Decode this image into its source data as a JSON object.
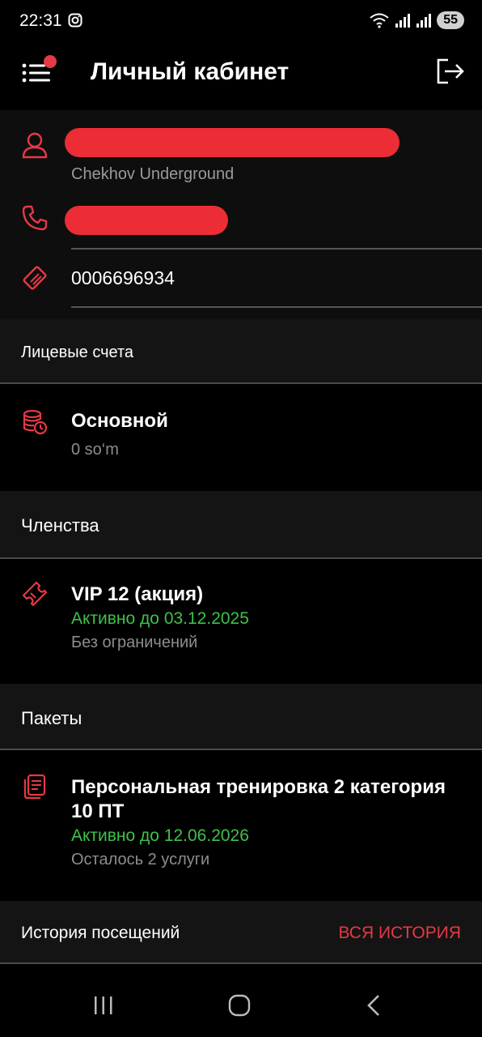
{
  "status": {
    "time": "22:31",
    "battery": "55"
  },
  "header": {
    "title": "Личный кабинет"
  },
  "profile": {
    "club": "Chekhov Underground",
    "card_number": "0006696934"
  },
  "accounts": {
    "title": "Лицевые счета",
    "items": [
      {
        "name": "Основной",
        "balance": "0 so‘m"
      }
    ]
  },
  "memberships": {
    "title": "Членства",
    "items": [
      {
        "name": "VIP 12 (акция)",
        "status": "Активно до 03.12.2025",
        "note": "Без ограничений"
      }
    ]
  },
  "packages": {
    "title": "Пакеты",
    "items": [
      {
        "name_line1": "Персональная тренировка 2 категория",
        "name_line2": "10 ПТ",
        "status": "Активно до 12.06.2026",
        "note": "Осталось 2 услуги"
      }
    ]
  },
  "history": {
    "title": "История посещений",
    "link": "ВСЯ ИСТОРИЯ"
  },
  "colors": {
    "accent": "#e53945",
    "active": "#3ec14a",
    "background": "#000000"
  },
  "icons": {
    "menu": "menu-icon",
    "logout": "logout-icon",
    "user": "user-icon",
    "phone": "phone-icon",
    "card": "card-icon",
    "coins": "coins-icon",
    "ticket": "ticket-icon",
    "package": "package-icon"
  }
}
